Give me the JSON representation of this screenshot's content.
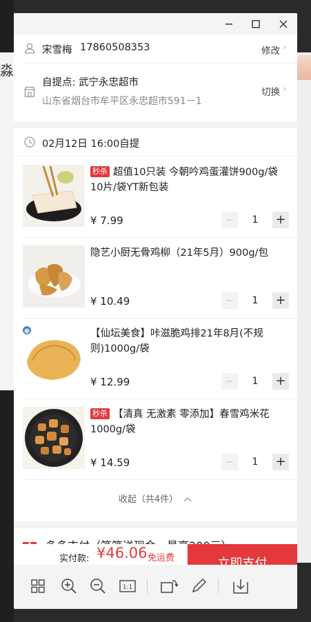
{
  "window": {
    "minimize_glyph": "—",
    "maximize_glyph": "☐",
    "close_glyph": "✕"
  },
  "background": {
    "left_text": "淼"
  },
  "address": {
    "name": "宋雪梅",
    "phone": "17860508353",
    "edit_label": "修改",
    "pickup_label": "自提点: 武宁永忠超市",
    "pickup_address": "山东省烟台市牟平区永忠超市591－1",
    "switch_label": "切换"
  },
  "delivery": {
    "time_label": "02月12日 16:00自提"
  },
  "products": [
    {
      "badge": "秒杀",
      "title": "超值10只装 今朝吟鸡蛋灌饼900g/袋 10片/袋YT新包装",
      "price": "¥ 7.99",
      "qty": "1"
    },
    {
      "badge": "",
      "title": "隐艺小厨无骨鸡柳（21年5月）900g/包",
      "price": "¥ 10.49",
      "qty": "1"
    },
    {
      "badge": "",
      "title": "【仙坛美食】咔滋脆鸡排21年8月(不规则)1000g/袋",
      "price": "¥ 12.99",
      "qty": "1"
    },
    {
      "badge": "秒杀",
      "title": "【清真 无激素 零添加】春雪鸡米花1000g/袋",
      "price": "¥ 14.59",
      "qty": "1"
    }
  ],
  "collapse_label": "收起（共4件）",
  "payment_method_partial": "多多支付（笔笔送现金，最高200元）",
  "footer": {
    "total_label": "实付款:",
    "total_amount": "¥46.06",
    "shipping_note": "免运费",
    "pay_button": "立即支付"
  },
  "colors": {
    "accent": "#e4393c",
    "background": "#f2f2f2",
    "card": "#ffffff",
    "muted_text": "#999999"
  },
  "icons": {
    "steppers": {
      "minus": "−",
      "plus": "+"
    }
  }
}
